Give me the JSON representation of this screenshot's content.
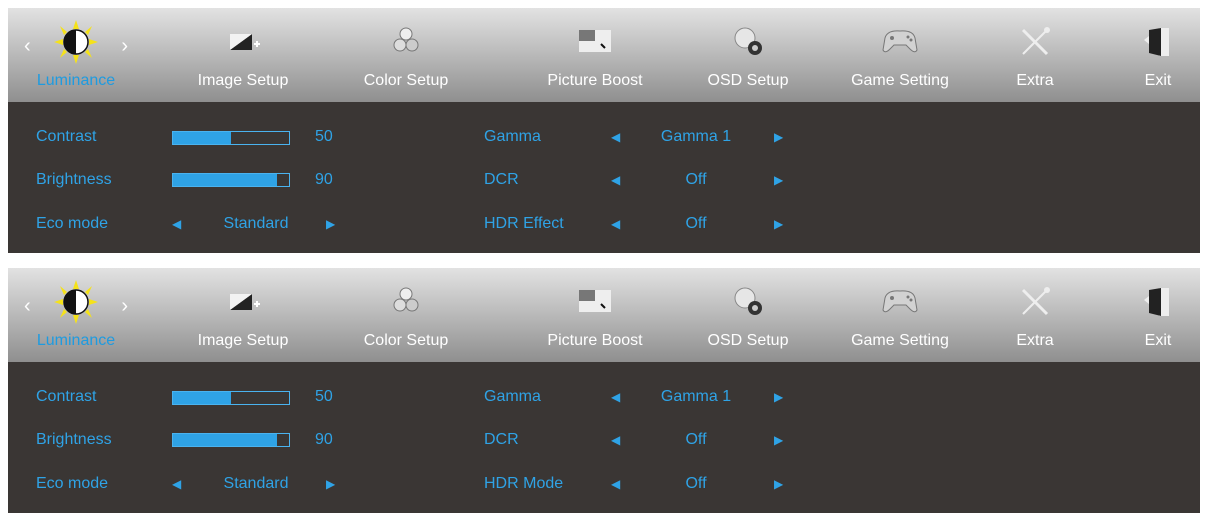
{
  "menus": [
    {
      "tabs": [
        {
          "label": "Luminance",
          "icon": "sun-icon",
          "active": true
        },
        {
          "label": "Image Setup",
          "icon": "image-setup-icon"
        },
        {
          "label": "Color Setup",
          "icon": "color-setup-icon"
        },
        {
          "label": "Picture Boost",
          "icon": "picture-boost-icon"
        },
        {
          "label": "OSD Setup",
          "icon": "osd-setup-icon"
        },
        {
          "label": "Game Setting",
          "icon": "gamepad-icon"
        },
        {
          "label": "Extra",
          "icon": "tools-icon"
        },
        {
          "label": "Exit",
          "icon": "exit-door-icon"
        }
      ],
      "contrast": {
        "label": "Contrast",
        "value": "50",
        "level": 0.5
      },
      "brightness": {
        "label": "Brightness",
        "value": "90",
        "level": 0.9
      },
      "eco_mode": {
        "label": "Eco mode",
        "value": "Standard"
      },
      "gamma": {
        "label": "Gamma",
        "value": "Gamma 1"
      },
      "dcr": {
        "label": "DCR",
        "value": "Off"
      },
      "hdr": {
        "label": "HDR Effect",
        "value": "Off"
      }
    },
    {
      "tabs": [
        {
          "label": "Luminance",
          "icon": "sun-icon",
          "active": true
        },
        {
          "label": "Image Setup",
          "icon": "image-setup-icon"
        },
        {
          "label": "Color Setup",
          "icon": "color-setup-icon"
        },
        {
          "label": "Picture Boost",
          "icon": "picture-boost-icon"
        },
        {
          "label": "OSD Setup",
          "icon": "osd-setup-icon"
        },
        {
          "label": "Game Setting",
          "icon": "gamepad-icon"
        },
        {
          "label": "Extra",
          "icon": "tools-icon"
        },
        {
          "label": "Exit",
          "icon": "exit-door-icon"
        }
      ],
      "contrast": {
        "label": "Contrast",
        "value": "50",
        "level": 0.5
      },
      "brightness": {
        "label": "Brightness",
        "value": "90",
        "level": 0.9
      },
      "eco_mode": {
        "label": "Eco mode",
        "value": "Standard"
      },
      "gamma": {
        "label": "Gamma",
        "value": "Gamma 1"
      },
      "dcr": {
        "label": "DCR",
        "value": "Off"
      },
      "hdr": {
        "label": "HDR Mode",
        "value": "Off"
      }
    }
  ],
  "colors": {
    "accent": "#2fa3e6",
    "panel": "#3a3634",
    "sun": "#f5e21a"
  }
}
